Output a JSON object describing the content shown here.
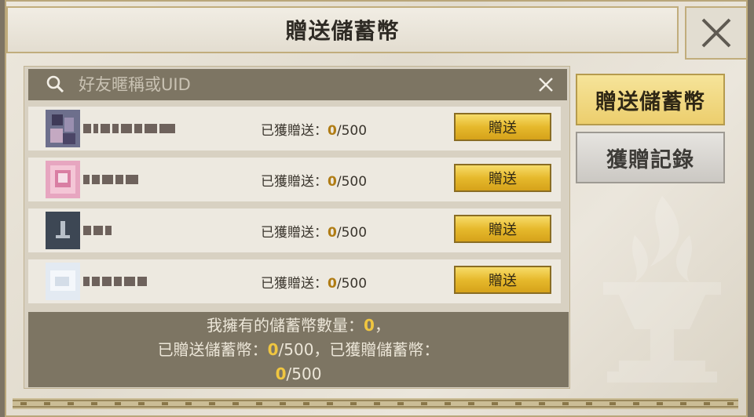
{
  "dialog": {
    "title": "贈送儲蓄幣"
  },
  "search": {
    "placeholder": "好友暱稱或UID"
  },
  "rows": [
    {
      "received_label": "已獲贈送：",
      "current": "0",
      "limit": "/500",
      "button": "贈送"
    },
    {
      "received_label": "已獲贈送：",
      "current": "0",
      "limit": "/500",
      "button": "贈送"
    },
    {
      "received_label": "已獲贈送：",
      "current": "0",
      "limit": "/500",
      "button": "贈送"
    },
    {
      "received_label": "已獲贈送：",
      "current": "0",
      "limit": "/500",
      "button": "贈送"
    }
  ],
  "summary": {
    "line1_prefix": "我擁有的儲蓄幣數量：",
    "owned": "0",
    "line1_suffix": "，",
    "line2_prefix": "已贈送儲蓄幣：",
    "sent": "0",
    "sent_limit": "/500",
    "line2_mid": "，已獲贈儲蓄幣：",
    "received": "0",
    "received_limit": "/500"
  },
  "side": {
    "gift_tab": "贈送儲蓄幣",
    "record_tab": "獲贈記錄"
  },
  "colors": {
    "gold_button": "#e6b92c",
    "highlight": "#f0c640",
    "panel_dark": "#7d7563"
  }
}
